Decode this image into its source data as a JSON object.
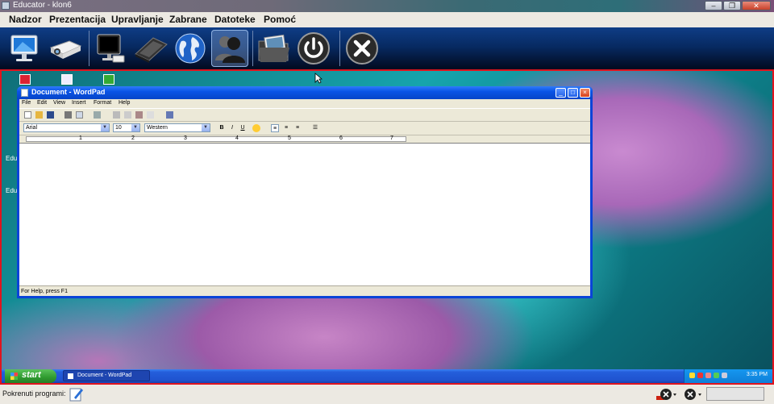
{
  "window": {
    "title": "Educator - klon6",
    "controls": {
      "minimize": "–",
      "maximize": "❐",
      "close": "✕"
    }
  },
  "menubar": {
    "items": [
      "Nadzor",
      "Prezentacija",
      "Upravljanje",
      "Zabrane",
      "Datoteke",
      "Pomoć"
    ]
  },
  "toolbar": {
    "buttons": [
      {
        "icon": "monitor-icon"
      },
      {
        "icon": "projector-icon"
      },
      {
        "icon": "blank-screen-icon"
      },
      {
        "icon": "keyboard-icon"
      },
      {
        "icon": "globe-icon"
      },
      {
        "icon": "users-icon",
        "active": true
      },
      {
        "icon": "folder-photo-icon"
      },
      {
        "icon": "power-icon"
      },
      {
        "icon": "close-icon"
      }
    ]
  },
  "remote": {
    "desktop_side_labels": [
      "Edu",
      "Edu"
    ],
    "wordpad": {
      "title": "Document - WordPad",
      "menu": [
        "File",
        "Edit",
        "View",
        "Insert",
        "Format",
        "Help"
      ],
      "font": "Arial",
      "size": "10",
      "script": "Western",
      "format_buttons": [
        "B",
        "I",
        "U"
      ],
      "ruler_numbers": [
        "1",
        "2",
        "3",
        "4",
        "5",
        "6",
        "7"
      ],
      "status": "For Help, press F1"
    },
    "taskbar": {
      "start": "start",
      "task": "Document - WordPad",
      "clock": "3:35 PM"
    }
  },
  "statusbar": {
    "label": "Pokrenuti programi:"
  },
  "colors": {
    "accent_border": "#e0141e",
    "toolbar_top": "#0f3d86",
    "xp_blue": "#245edb"
  }
}
